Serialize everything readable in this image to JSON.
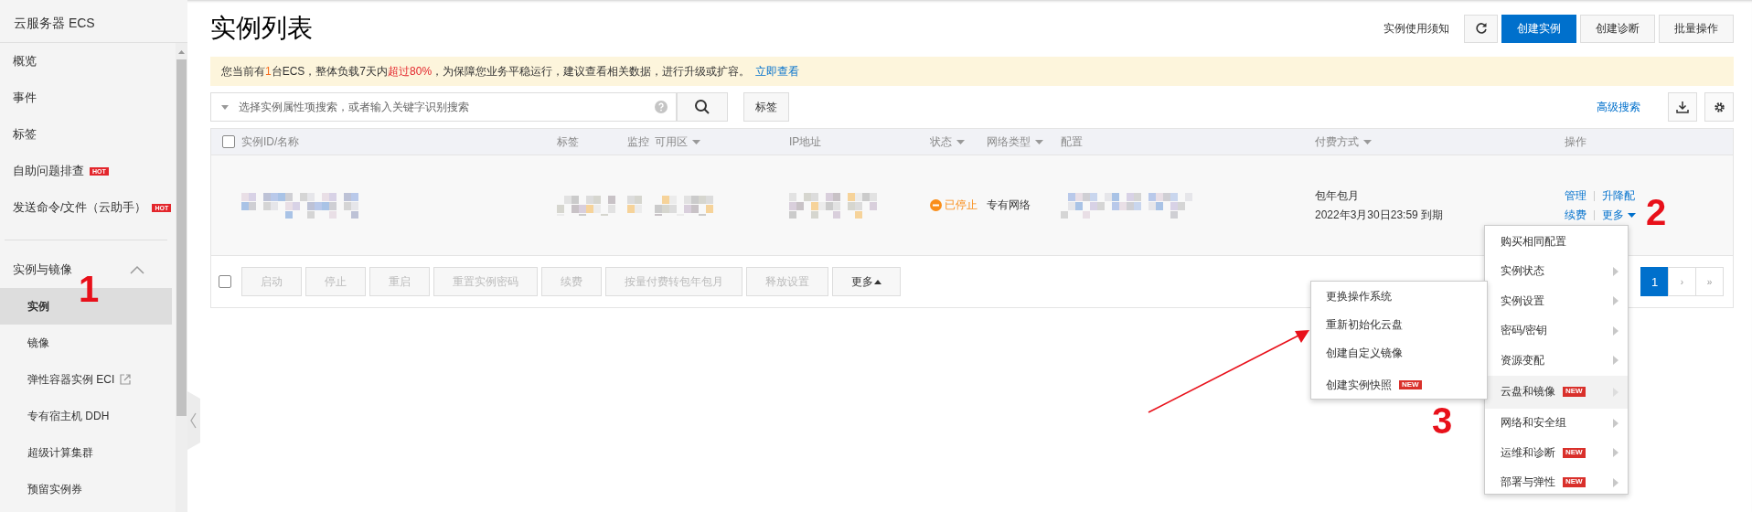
{
  "sidebar": {
    "title": "云服务器 ECS",
    "items": [
      {
        "label": "概览"
      },
      {
        "label": "事件"
      },
      {
        "label": "标签"
      },
      {
        "label": "自助问题排查",
        "badge": "HOT"
      },
      {
        "label": "发送命令/文件（云助手）",
        "badge": "HOT"
      }
    ],
    "groups": [
      {
        "label": "实例与镜像",
        "expanded": true,
        "children": [
          {
            "label": "实例",
            "selected": true,
            "external": false
          },
          {
            "label": "镜像",
            "selected": false,
            "external": false
          },
          {
            "label": "弹性容器实例 ECI",
            "selected": false,
            "external": true
          },
          {
            "label": "专有宿主机 DDH",
            "selected": false,
            "external": false
          },
          {
            "label": "超级计算集群",
            "selected": false,
            "external": false
          },
          {
            "label": "预留实例券",
            "selected": false,
            "external": false
          }
        ]
      }
    ]
  },
  "page_title": "实例列表",
  "toolbar": {
    "notice": "实例使用须知",
    "buttons": [
      {
        "kind": "refresh"
      },
      {
        "kind": "primary",
        "label": "创建实例"
      },
      {
        "kind": "default",
        "label": "创建诊断"
      },
      {
        "kind": "default",
        "label": "批量操作"
      }
    ]
  },
  "alert": {
    "segments": [
      {
        "text": "您当前有"
      },
      {
        "text": "1",
        "color": "#f76b1c"
      },
      {
        "text": "台ECS，整体负载7天内"
      },
      {
        "text": "超过80%",
        "color": "#e3262c"
      },
      {
        "text": "，为保障您业务平稳运行，建议查看相关数据，进行升级或扩容。"
      }
    ],
    "link": "立即查看"
  },
  "search": {
    "placeholder": "选择实例属性项搜索，或者输入关键字识别搜索",
    "tag_button": "标签",
    "advanced_search": "高级搜索"
  },
  "table_tools": [
    {
      "kind": "download"
    },
    {
      "kind": "settings"
    }
  ],
  "table": {
    "select_all": {
      "checked": false
    },
    "columns": [
      {
        "label": "实例ID/名称",
        "filter": false
      },
      {
        "label": "标签",
        "filter": false
      },
      {
        "label": "监控",
        "filter": false
      },
      {
        "label": "可用区",
        "filter": true
      },
      {
        "label": "IP地址",
        "filter": false
      },
      {
        "label": "状态",
        "filter": true
      },
      {
        "label": "网络类型",
        "filter": true
      },
      {
        "label": "配置",
        "filter": false
      },
      {
        "label": "付费方式",
        "filter": true
      },
      {
        "label": "操作",
        "filter": false
      }
    ],
    "rows": [
      {
        "status": {
          "label": "已停止",
          "kind": "stopped"
        },
        "network": "专有网络",
        "billing": "包年包月",
        "expiry": "2022年3月30日23:59 到期",
        "actions": [
          {
            "label": "管理",
            "dropdown": false
          },
          {
            "label": "升降配",
            "dropdown": false
          },
          {
            "label": "续费",
            "dropdown": false
          },
          {
            "label": "更多",
            "dropdown": true
          }
        ]
      }
    ]
  },
  "bulk": {
    "checked": false,
    "buttons": [
      {
        "label": "启动",
        "disabled": true,
        "dropdown": false
      },
      {
        "label": "停止",
        "disabled": true,
        "dropdown": false
      },
      {
        "label": "重启",
        "disabled": true,
        "dropdown": false
      },
      {
        "label": "重置实例密码",
        "disabled": true,
        "dropdown": false
      },
      {
        "label": "续费",
        "disabled": true,
        "dropdown": false
      },
      {
        "label": "按量付费转包年包月",
        "disabled": true,
        "dropdown": false
      },
      {
        "label": "释放设置",
        "disabled": true,
        "dropdown": false
      },
      {
        "label": "更多",
        "disabled": false,
        "dropdown": true
      }
    ]
  },
  "pagination": [
    {
      "kind": "page",
      "label": "1",
      "selected": true
    },
    {
      "kind": "next",
      "label": "›",
      "selected": false
    },
    {
      "kind": "last",
      "label": "»",
      "selected": false
    }
  ],
  "more_menu": {
    "items": [
      {
        "label": "购买相同配置",
        "submenu": false,
        "selected": false
      },
      {
        "label": "实例状态",
        "submenu": true,
        "selected": false
      },
      {
        "label": "实例设置",
        "submenu": true,
        "selected": false
      },
      {
        "label": "密码/密钥",
        "submenu": true,
        "selected": false
      },
      {
        "label": "资源变配",
        "submenu": true,
        "selected": false
      },
      {
        "label": "云盘和镜像",
        "submenu": true,
        "selected": true,
        "badge": "NEW"
      },
      {
        "label": "网络和安全组",
        "submenu": true,
        "selected": false
      },
      {
        "label": "运维和诊断",
        "submenu": true,
        "selected": false,
        "badge": "NEW"
      },
      {
        "label": "部署与弹性",
        "submenu": true,
        "selected": false,
        "badge": "NEW"
      }
    ]
  },
  "submenu": {
    "items": [
      {
        "label": "更换操作系统"
      },
      {
        "label": "重新初始化云盘"
      },
      {
        "label": "创建自定义镜像"
      },
      {
        "label": "创建实例快照",
        "badge": "NEW"
      }
    ]
  },
  "annotations": [
    {
      "text": "1",
      "kind": "sidebar"
    },
    {
      "text": "2",
      "kind": "row"
    },
    {
      "text": "3",
      "kind": "menu"
    }
  ]
}
